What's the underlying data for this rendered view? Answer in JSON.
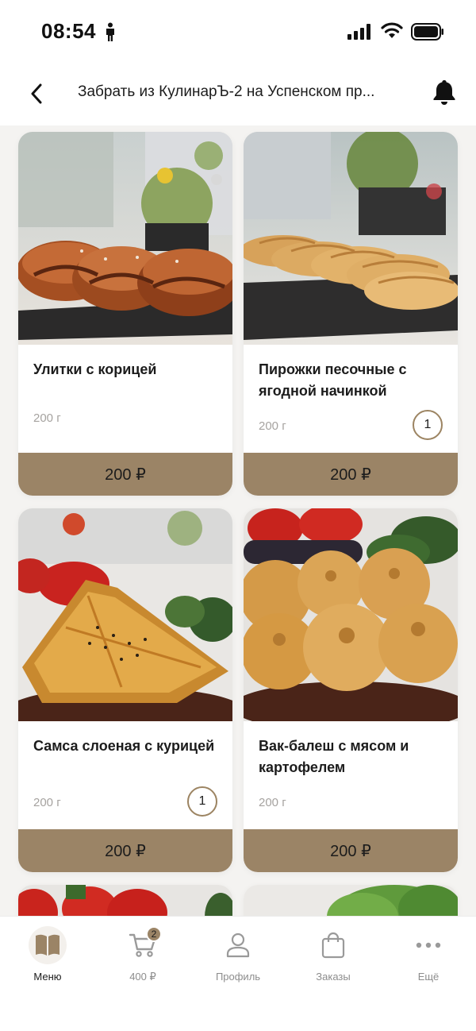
{
  "status_bar": {
    "time": "08:54",
    "icons": [
      "person-icon",
      "signal-icon",
      "wifi-icon",
      "battery-icon"
    ]
  },
  "header": {
    "back_icon": "chevron-left-icon",
    "title": "Забрать из КулинарЪ-2 на Успенском пр...",
    "bell_icon": "bell-icon"
  },
  "products": [
    {
      "title": "Улитки с корицей",
      "weight": "200 г",
      "price": "200 ₽",
      "quantity": null
    },
    {
      "title": "Пирожки песочные с ягодной начинкой",
      "weight": "200 г",
      "price": "200 ₽",
      "quantity": "1"
    },
    {
      "title": "Самса слоеная с курицей",
      "weight": "200 г",
      "price": "200 ₽",
      "quantity": "1"
    },
    {
      "title": "Вак-балеш с мясом и картофелем",
      "weight": "200 г",
      "price": "200 ₽",
      "quantity": null
    }
  ],
  "tab_bar": {
    "tabs": [
      {
        "label": "Меню",
        "icon": "book-icon",
        "active": true
      },
      {
        "label": "400 ₽",
        "icon": "cart-icon",
        "badge": "2"
      },
      {
        "label": "Профиль",
        "icon": "person-icon"
      },
      {
        "label": "Заказы",
        "icon": "bag-icon"
      },
      {
        "label": "Ещё",
        "icon": "more-icon"
      }
    ]
  },
  "colors": {
    "accent": "#9b8466",
    "background": "#f4f3f1",
    "card": "#ffffff",
    "muted_text": "#a6a3a0"
  }
}
